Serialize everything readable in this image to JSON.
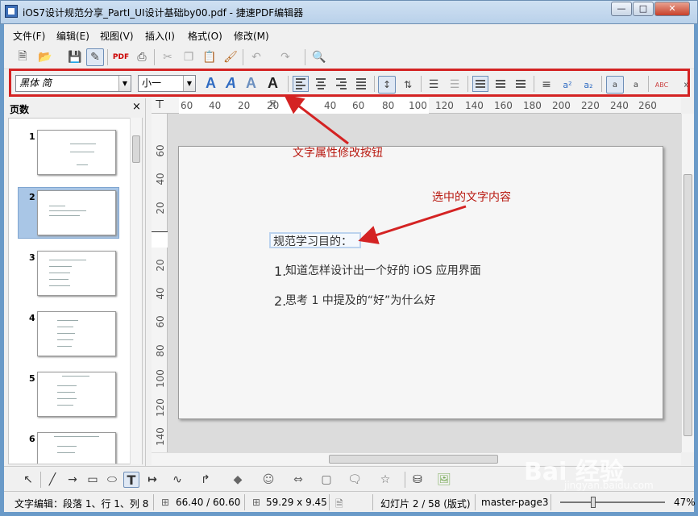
{
  "window": {
    "title": "iOS7设计规范分享_PartI_UI设计基础by00.pdf - 捷速PDF编辑器"
  },
  "menu": [
    "文件(F)",
    "编辑(E)",
    "视图(V)",
    "插入(I)",
    "格式(O)",
    "修改(M)"
  ],
  "format_toolbar": {
    "font_name": "黑体 简",
    "font_size": "小一",
    "bold_a": "A"
  },
  "pages_panel": {
    "title": "页数",
    "close": "×",
    "pages": [
      "1",
      "2",
      "3",
      "4",
      "5",
      "6"
    ],
    "selected": "2"
  },
  "ruler": {
    "horizontal": [
      "60",
      "40",
      "20",
      "20",
      "40",
      "60",
      "80",
      "100",
      "120",
      "140",
      "160",
      "180",
      "200",
      "220",
      "240",
      "260"
    ],
    "vertical": [
      "60",
      "40",
      "20",
      "20",
      "40",
      "60",
      "80",
      "100",
      "120",
      "140"
    ]
  },
  "slide": {
    "heading": "规范学习目的：",
    "items": [
      {
        "num": "1.",
        "text": "知道怎样设计出一个好的 iOS 应用界面"
      },
      {
        "num": "2.",
        "text": "思考 1 中提及的“好”为什么好"
      }
    ]
  },
  "annotations": {
    "toolbar_note": "文字属性修改按钮",
    "text_note": "选中的文字内容"
  },
  "statusbar": {
    "mode": "文字编辑：段落 1、行 1、列 8",
    "position": "66.40 / 60.60",
    "size": "59.29 x 9.45",
    "slide": "幻灯片 2 / 58 (版式)",
    "master": "master-page3",
    "zoom": "47%"
  },
  "watermark": {
    "brand": "Bai 经验",
    "url": "jingyan.baidu.com"
  },
  "colors": {
    "annotation": "#b8170e",
    "highlight_box": "#d42323",
    "selected_page": "#a9c6e6"
  }
}
